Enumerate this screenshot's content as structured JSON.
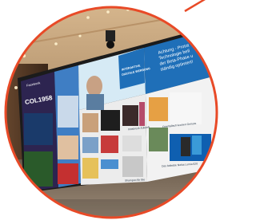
{
  "photo": {
    "subject": "video wall displaying news tiles in a shopping mall",
    "accent_color": "#e84a27",
    "screen_blue": "#1f6fb8"
  },
  "wall": {
    "banner_lines": [
      "Achtung - Protot",
      "Technologie befi",
      "der Beta-Phase u",
      "ständig optimiert!"
    ],
    "left_panel_title": "COL1958",
    "left_panel_sub": "Facebook",
    "promo_lines": [
      "INTERAKTIVE",
      "DIGITALE WERBUNG"
    ],
    "tile_caption_1": "Innsbruck Zukunft",
    "tile_caption_2": "Orientalisch kochen Genuss",
    "tile_caption_3": "Das beliebte Nokia Lumia 620",
    "tile_caption_4": "Shampoo für Bio"
  }
}
